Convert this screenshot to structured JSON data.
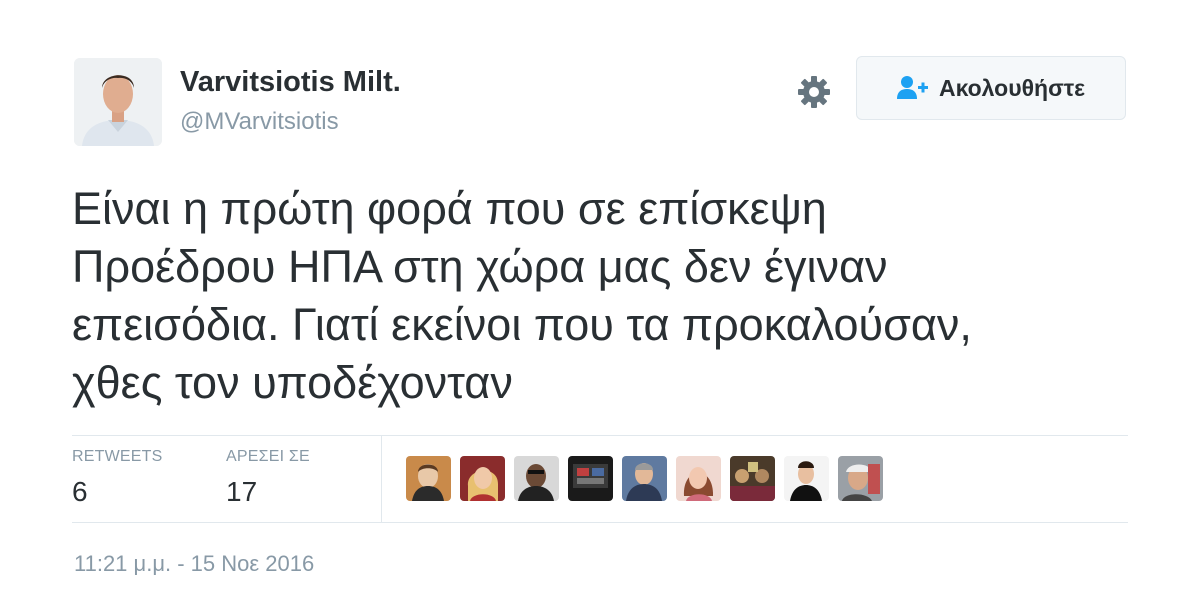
{
  "author": {
    "display_name": "Varvitsiotis Milt.",
    "screen_name": "@MVarvitsiotis"
  },
  "follow_button": {
    "label": "Ακολουθήστε",
    "icon": "follow-user-icon"
  },
  "settings": {
    "icon": "gear-icon"
  },
  "tweet": {
    "lines": [
      "Είναι η πρώτη φορά που σε επίσκεψη",
      "Προέδρου ΗΠΑ στη χώρα μας δεν έγιναν",
      "επεισόδια. Γιατί εκείνοι που τα προκαλούσαν,",
      "χθες τον υποδέχονταν"
    ]
  },
  "stats": {
    "retweets_label": "RETWEETS",
    "retweets_value": "6",
    "likes_label": "ΑΡΕΣΕΙ ΣΕ",
    "likes_value": "17"
  },
  "timestamp": "11:21 μ.μ. - 15 Νοε 2016",
  "colors": {
    "text": "#292f33",
    "muted": "#8899a6",
    "accent": "#1da1f2",
    "divider": "#e1e8ed",
    "button_bg": "#f5f8fa"
  }
}
